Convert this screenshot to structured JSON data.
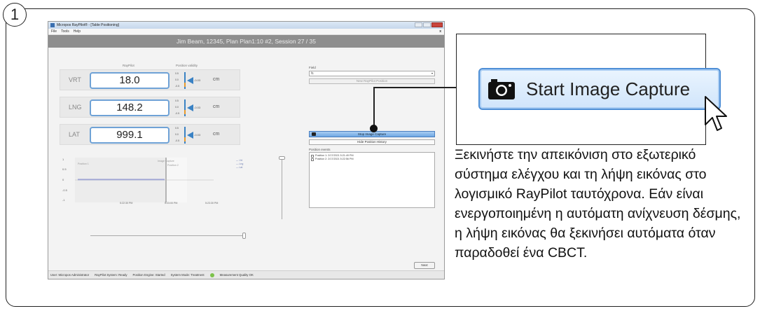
{
  "step_number": "1",
  "window": {
    "title": "Micropos RayPilot® - [Table Positioning]",
    "menu": [
      "File",
      "Tools",
      "Help"
    ],
    "close_x": "x",
    "header": "Jim Beam, 12345, Plan Plan1:10 #2, Session 27 / 35"
  },
  "positions": {
    "col_raypilot": "RayPilot",
    "col_validity": "Position validity",
    "rows": [
      {
        "label": "VRT",
        "value": "18.0",
        "offset": "-0.03",
        "unit": "cm",
        "ticks": [
          "0.5",
          "0.0",
          "-0.5"
        ]
      },
      {
        "label": "LNG",
        "value": "148.2",
        "offset": "-0.03",
        "unit": "cm",
        "ticks": [
          "0.5",
          "0.0",
          "-0.5"
        ]
      },
      {
        "label": "LAT",
        "value": "999.1",
        "offset": "-0.03",
        "unit": "cm",
        "ticks": [
          "0.5",
          "0.0",
          "-0.5"
        ]
      }
    ]
  },
  "chart": {
    "y_ticks": [
      "1",
      "0.5",
      "0",
      "-0.5",
      "-1"
    ],
    "x_ticks": [
      "5:22:30 PM",
      "5:23:00 PM",
      "5:23:30 PM"
    ],
    "annotations": [
      "Position 1",
      "Image Capture",
      "Position 2"
    ],
    "legend": [
      "Vrt",
      "Lng",
      "Lat"
    ]
  },
  "field": {
    "label": "Field",
    "value": "f1",
    "new_position_label": "New RayPilot Position"
  },
  "capture_button_label": "Stop Image Capture",
  "hide_history_label": "Hide Position History",
  "events": {
    "label": "Position events",
    "items": [
      "Position 1: 2/17/2021 5:21:49 PM",
      "Position 2: 2/17/2021 5:22:56 PM"
    ]
  },
  "next_label": "Next",
  "status": {
    "user": "User: Micropos Administrator",
    "system": "RayPilot System: Ready",
    "engine": "Position Engine: Started",
    "mode": "System Mode: Treatment",
    "quality": "Measurement Quality OK"
  },
  "callout": {
    "button_label": "Start Image Capture",
    "icon": "camera-icon"
  },
  "description": "Ξεκινήστε την απεικόνιση στο εξωτερικό σύστημα ελέγχου και τη λήψη εικόνας στο λογισμικό RayPilot ταυτόχρονα. Εάν είναι ενεργοποιημένη η αυτόματη ανίχνευση δέσμης, η λήψη εικόνας θα ξεκινήσει αυτόματα όταν παραδοθεί ένα CBCT.",
  "colors": {
    "accent": "#4f8fd6",
    "header_gray": "#8e8e8e",
    "status_ok": "#7cc24b"
  }
}
